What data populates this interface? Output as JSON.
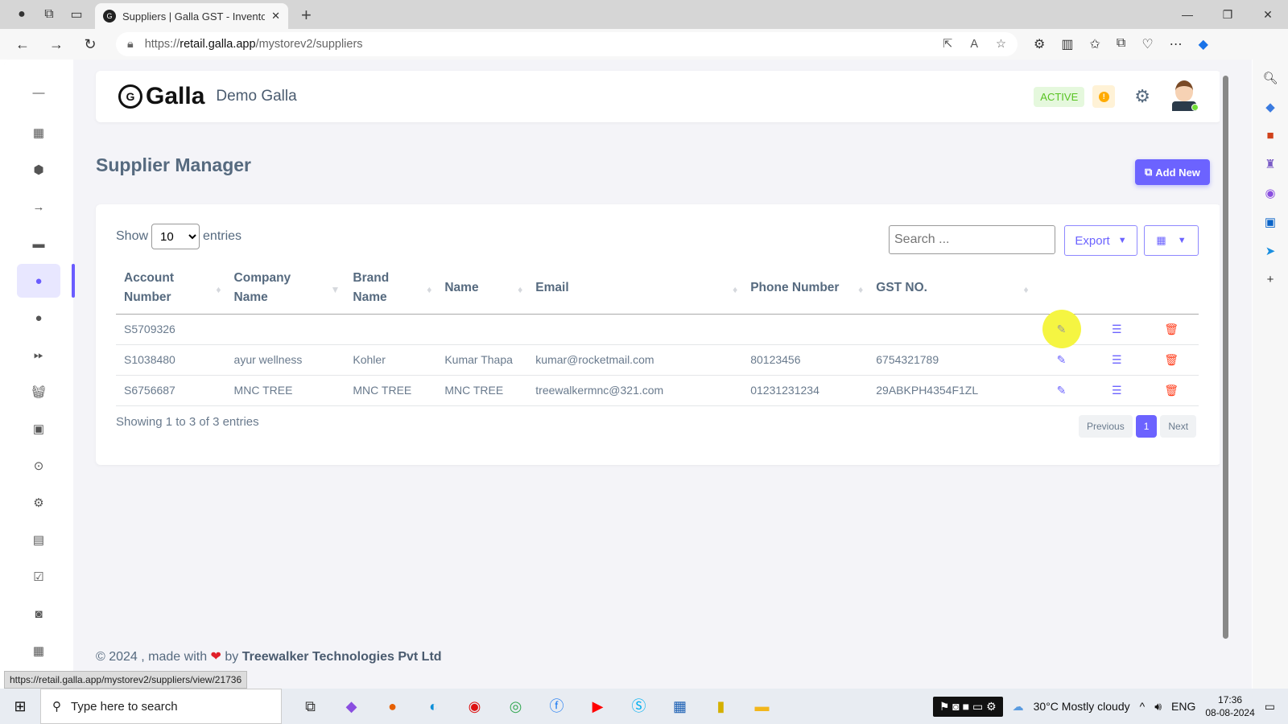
{
  "browser": {
    "tab_title": "Suppliers | Galla GST - Inventory",
    "url_host": "retail.galla.app",
    "url_prefix": "https://",
    "url_path": "/mystorev2/suppliers",
    "status_url": "https://retail.galla.app/mystorev2/suppliers/view/21736"
  },
  "header": {
    "logo_text": "Galla",
    "store_name": "Demo Galla",
    "status_badge": "ACTIVE",
    "alert": "!"
  },
  "page": {
    "title": "Supplier Manager",
    "add_new_label": "Add New"
  },
  "table_controls": {
    "show_label": "Show",
    "entries_label": "entries",
    "page_size": "10",
    "search_placeholder": "Search ...",
    "export_label": "Export"
  },
  "table": {
    "columns": [
      "Account Number",
      "Company Name",
      "Brand Name",
      "Name",
      "Email",
      "Phone Number",
      "GST NO."
    ],
    "rows": [
      [
        "S5709326",
        "",
        "",
        "",
        "",
        "",
        ""
      ],
      [
        "S1038480",
        "ayur wellness",
        "Kohler",
        "Kumar Thapa",
        "kumar@rocketmail.com",
        "80123456",
        "6754321789"
      ],
      [
        "S6756687",
        "MNC TREE",
        "MNC TREE",
        "MNC TREE",
        "treewalkermnc@321.com",
        "01231231234",
        "29ABKPH4354F1ZL"
      ]
    ]
  },
  "footer": {
    "info": "Showing 1 to 3 of 3 entries",
    "prev": "Previous",
    "page": "1",
    "next": "Next",
    "copyright": "© 2024 , made with",
    "by": "by",
    "company": "Treewalker Technologies Pvt Ltd"
  },
  "taskbar": {
    "search_placeholder": "Type here to search",
    "weather": "30°C  Mostly cloudy",
    "lang": "ENG",
    "time": "17:36",
    "date": "08-08-2024"
  },
  "colors": {
    "accent": "#6c63ff",
    "active": "#58c322",
    "danger": "#ff3e1d",
    "warning": "#ffab00"
  }
}
